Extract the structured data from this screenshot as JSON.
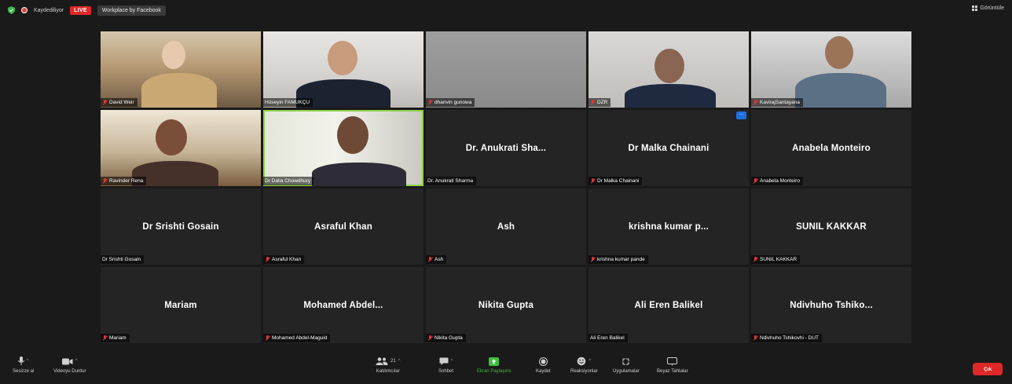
{
  "topbar": {
    "recording_label": "Kaydediliyor",
    "live_label": "LIVE",
    "workplace_label": "Workplace by Facebook",
    "view_label": "Görüntüle"
  },
  "colors": {
    "live_red": "#e02828",
    "active_speaker_border": "#8fd14f",
    "share_green": "#3fbf3f",
    "end_red": "#e02828"
  },
  "participants": [
    {
      "display": "",
      "plate": "David Weir",
      "muted": true,
      "video": true
    },
    {
      "display": "",
      "plate": "Hüseyin FAMUKÇU",
      "muted": false,
      "video": true
    },
    {
      "display": "",
      "plate": "dhanvin gunowa",
      "muted": true,
      "video": true
    },
    {
      "display": "",
      "plate": "DZR",
      "muted": true,
      "video": true
    },
    {
      "display": "",
      "plate": "KavirajSantayana",
      "muted": true,
      "video": true
    },
    {
      "display": "",
      "plate": "Ravinder Rena",
      "muted": true,
      "video": true
    },
    {
      "display": "",
      "plate": "Dr Dalia Chowdhury",
      "muted": false,
      "video": true,
      "active": true
    },
    {
      "display": "Dr. Anukrati Sha...",
      "plate": "Dr. Anukrati Sharma",
      "muted": false,
      "video": false
    },
    {
      "display": "Dr Malka Chainani",
      "plate": "Dr Malka Chainani",
      "muted": true,
      "video": false,
      "more_badge": "..."
    },
    {
      "display": "Anabela Monteiro",
      "plate": "Anabela Monteiro",
      "muted": true,
      "video": false
    },
    {
      "display": "Dr Srishti Gosain",
      "plate": "Dr Srishti Gosain",
      "muted": false,
      "video": false
    },
    {
      "display": "Asraful Khan",
      "plate": "Asraful Khan",
      "muted": true,
      "video": false
    },
    {
      "display": "Ash",
      "plate": "Ash",
      "muted": true,
      "video": false
    },
    {
      "display": "krishna kumar p...",
      "plate": "krishna kumar pande",
      "muted": true,
      "video": false
    },
    {
      "display": "SUNIL KAKKAR",
      "plate": "SUNIL KAKKAR",
      "muted": true,
      "video": false
    },
    {
      "display": "Mariam",
      "plate": "Mariam",
      "muted": true,
      "video": false
    },
    {
      "display": "Mohamed Abdel...",
      "plate": "Mohamed Abdel-Maguid",
      "muted": true,
      "video": false
    },
    {
      "display": "Nikita Gupta",
      "plate": "Nikita Gupta",
      "muted": true,
      "video": false
    },
    {
      "display": "Ali Eren Balikel",
      "plate": "Ali Eren Balikel",
      "muted": false,
      "video": false
    },
    {
      "display": "Ndivhuho Tshiko...",
      "plate": "Ndivhuho Tshikovhi - DUT",
      "muted": true,
      "video": false
    }
  ],
  "toolbar": {
    "mute_label": "Sesizze al",
    "video_label": "Videoyu Durdur",
    "participants_label": "Katılımcılar",
    "participants_count": "21",
    "chat_label": "Sohbet",
    "share_label": "Ekran Paylaşımı",
    "record_label": "Kaydet",
    "reactions_label": "Reaksiyonlar",
    "apps_label": "Uygulamalar",
    "whiteboard_label": "Beyaz Tahtalar",
    "end_label": "Çık"
  }
}
